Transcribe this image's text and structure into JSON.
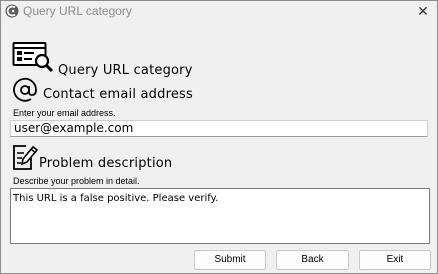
{
  "window": {
    "title": "Query URL category",
    "close_glyph": "✕"
  },
  "header": {
    "title": "Query URL category",
    "icon": "url-category-icon"
  },
  "contact": {
    "heading": "Contact email address",
    "icon": "at-sign-icon",
    "label": "Enter your email address.",
    "value": "user@example.com"
  },
  "problem": {
    "heading": "Problem description",
    "icon": "edit-document-icon",
    "label": "Describe your problem in detail.",
    "value": "This URL is a false positive. Please verify."
  },
  "buttons": {
    "submit": "Submit",
    "back": "Back",
    "exit": "Exit"
  }
}
